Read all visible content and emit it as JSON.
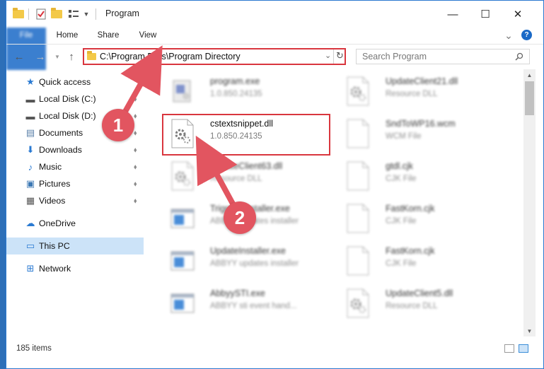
{
  "window": {
    "title": "Program",
    "controls": {
      "minimize": "—",
      "maximize": "☐",
      "close": "✕"
    }
  },
  "ribbon": {
    "tabs": [
      "File",
      "Home",
      "Share",
      "View"
    ],
    "help_symbol": "?",
    "collapse_symbol": "⌄"
  },
  "nav": {
    "address": "C:\\Program Files\\Program Directory",
    "search_placeholder": "Search Program"
  },
  "sidebar": {
    "items": [
      {
        "label": "Quick access",
        "icon": "star-icon",
        "glyph": "★",
        "color": "#2a7ad2",
        "pinned": false
      },
      {
        "label": "Local Disk (C:)",
        "icon": "disk-icon",
        "glyph": "▬",
        "color": "#555555",
        "pinned": true
      },
      {
        "label": "Local Disk (D:)",
        "icon": "disk-icon",
        "glyph": "▬",
        "color": "#555555",
        "pinned": true
      },
      {
        "label": "Documents",
        "icon": "document-icon",
        "glyph": "▤",
        "color": "#5a7fa8",
        "pinned": true
      },
      {
        "label": "Downloads",
        "icon": "download-icon",
        "glyph": "⬇",
        "color": "#2a7ad2",
        "pinned": true
      },
      {
        "label": "Music",
        "icon": "music-icon",
        "glyph": "♪",
        "color": "#2a7ad2",
        "pinned": true
      },
      {
        "label": "Pictures",
        "icon": "picture-icon",
        "glyph": "▣",
        "color": "#3c78b4",
        "pinned": true
      },
      {
        "label": "Videos",
        "icon": "video-icon",
        "glyph": "▦",
        "color": "#555555",
        "pinned": true
      },
      {
        "label": "OneDrive",
        "icon": "cloud-icon",
        "glyph": "☁",
        "color": "#2a7ad2",
        "pinned": false
      },
      {
        "label": "This PC",
        "icon": "computer-icon",
        "glyph": "▭",
        "color": "#2a7ad2",
        "pinned": false,
        "selected": true
      },
      {
        "label": "Network",
        "icon": "network-icon",
        "glyph": "⊞",
        "color": "#2a7ad2",
        "pinned": false
      }
    ],
    "pin_glyph": "📌"
  },
  "files": [
    {
      "name": "program.exe",
      "sub": "1.0.850.24135",
      "kind": "exe"
    },
    {
      "name": "UpdateClient21.dll",
      "sub": "Resource DLL",
      "kind": "dll"
    },
    {
      "name": "cstextsnippet.dll",
      "sub": "1.0.850.24135",
      "kind": "dll",
      "focus": true
    },
    {
      "name": "SndToWP16.wcm",
      "sub": "WCM File",
      "kind": "doc"
    },
    {
      "name": "UpdateClient63.dll",
      "sub": "Resource DLL",
      "kind": "dll"
    },
    {
      "name": "gtdl.cjk",
      "sub": "CJK File",
      "kind": "doc"
    },
    {
      "name": "TrigraphInstaller.exe",
      "sub": "ABBYY updates installer",
      "kind": "app"
    },
    {
      "name": "FastKorn.cjk",
      "sub": "CJK File",
      "kind": "doc"
    },
    {
      "name": "UpdateInstaller.exe",
      "sub": "ABBYY updates installer",
      "kind": "app"
    },
    {
      "name": "FastKorn.cjk",
      "sub": "CJK File",
      "kind": "doc"
    },
    {
      "name": "AbbyySTI.exe",
      "sub": "ABBYY sti event hand...",
      "kind": "app"
    },
    {
      "name": "UpdateClient5.dll",
      "sub": "Resource DLL",
      "kind": "dll"
    }
  ],
  "status": {
    "items_count": "185 items"
  },
  "callouts": [
    "1",
    "2"
  ],
  "colors": {
    "accent": "#1a69c7",
    "highlight": "#d9363e",
    "callout": "#e25560",
    "selected": "#cce3f8"
  }
}
